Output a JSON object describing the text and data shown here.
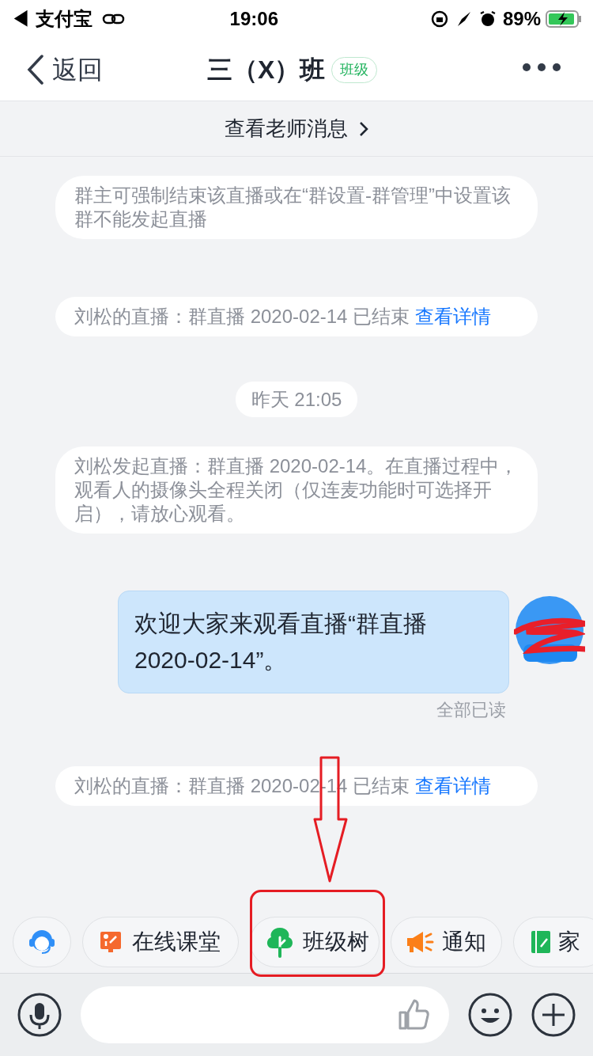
{
  "status_bar": {
    "back_app": "◀ 支付宝",
    "time": "19:06",
    "battery": "89%"
  },
  "nav": {
    "back": "返回",
    "title": "三（X）班",
    "tag": "班级"
  },
  "banner": {
    "label": "查看老师消息"
  },
  "messages": [
    {
      "kind": "system",
      "text": "群主可强制结束该直播或在“群设置-群管理”中设置该群不能发起直播"
    },
    {
      "kind": "system",
      "text": "刘松的直播：群直播 2020-02-14 已结束 ",
      "link": "查看详情"
    },
    {
      "kind": "time",
      "text": "昨天 21:05"
    },
    {
      "kind": "system",
      "text": "刘松发起直播：群直播 2020-02-14。在直播过程中，观看人的摄像头全程关闭（仅连麦功能时可选择开启），请放心观看。"
    },
    {
      "kind": "mine",
      "text": "欢迎大家来观看直播“群直播 2020-02-14”。",
      "receipt": "全部已读"
    },
    {
      "kind": "system",
      "text": "刘松的直播：群直播 2020-02-14 已结束 ",
      "link": "查看详情"
    }
  ],
  "quick_actions": [
    {
      "kind": "support"
    },
    {
      "kind": "classroom",
      "label": "在线课堂"
    },
    {
      "kind": "tree",
      "label": "班级树"
    },
    {
      "kind": "notice",
      "label": "通知"
    },
    {
      "kind": "homework",
      "label": "家"
    }
  ]
}
